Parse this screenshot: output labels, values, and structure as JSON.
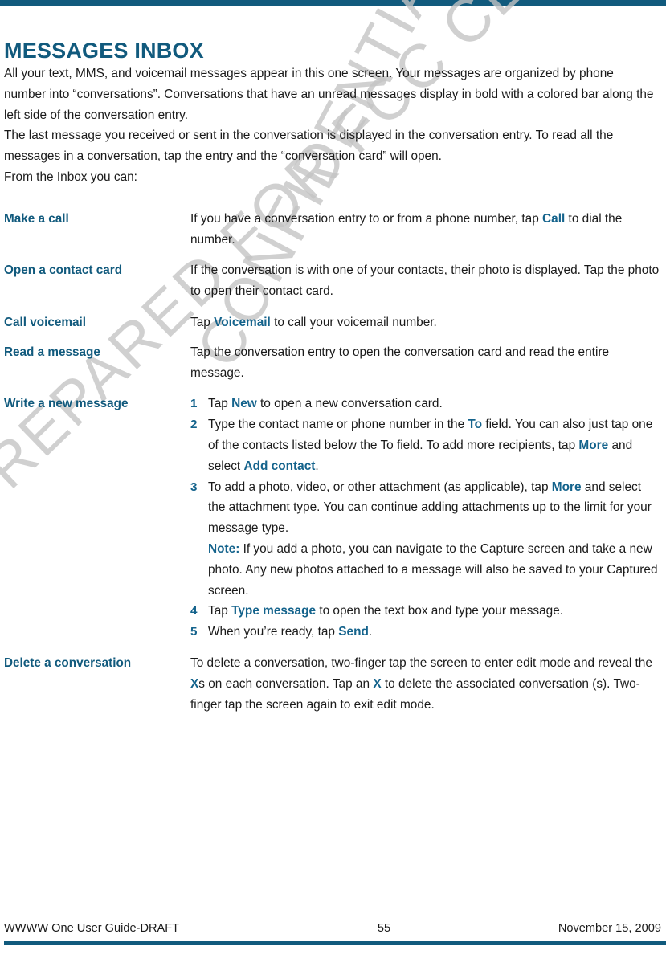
{
  "colors": {
    "accent": "#115a7d",
    "keyword": "#14638c",
    "body_text": "#1a1a1a",
    "watermark": "#c4c4c4"
  },
  "header": {
    "title": "MESSAGES INBOX"
  },
  "watermark": {
    "line1": "PREPARED FOR FCC CERTIFICATION",
    "line2": "CONFIDENTIAL"
  },
  "intro": {
    "para1": "All your text, MMS, and voicemail messages appear in this one screen. Your messages are organized by phone number into “conversations”. Conversations that have an unread messages display in bold with a colored bar along the left side of the conversation entry.",
    "para2": "The last message you received or sent in the conversation is displayed in the conversation entry. To read all the messages in a conversation, tap the entry and the “conversation card” will open.",
    "para3": "From the Inbox you can:"
  },
  "tasks": {
    "make_a_call": {
      "term": "Make a call",
      "desc_part1": "If you have a conversation entry to or from a phone number, tap ",
      "kw1": "Call",
      "desc_part2": " to dial the number."
    },
    "open_contact_card": {
      "term": "Open a contact card",
      "desc": "If the conversation is with one of your contacts, their photo is displayed. Tap the photo to open their contact card."
    },
    "call_voicemail": {
      "term": "Call voicemail",
      "desc_part1": "Tap ",
      "kw1": "Voicemail",
      "desc_part2": " to call your voicemail number."
    },
    "read_a_message": {
      "term": "Read a message",
      "desc": "Tap the conversation entry to open the conversation card and read the entire message."
    },
    "write_new_message": {
      "term": "Write a new message",
      "steps": [
        {
          "num": "1",
          "part1": "Tap ",
          "kw1": "New",
          "part2": " to open a new conversation card."
        },
        {
          "num": "2",
          "part1": "Type the contact name or phone number in the ",
          "kw1": "To",
          "part2": " field. You can also just tap one of the contacts listed below the To field. To add more recipients, tap ",
          "kw2": "More",
          "part3": " and select ",
          "kw3": "Add contact",
          "part4": "."
        },
        {
          "num": "3",
          "part1": "To add a photo, video, or other attachment (as applicable), tap ",
          "kw1": "More",
          "part2": " and select the attachment type. You can continue adding attachments up to the limit for your message type.",
          "note_label": "Note:",
          "note_text": " If you add a photo, you can navigate to the Capture screen and take a new photo. Any new photos attached to a message will also be saved to your Captured screen."
        },
        {
          "num": "4",
          "part1": "Tap ",
          "kw1": "Type message",
          "part2": " to open the text box and type your message."
        },
        {
          "num": "5",
          "part1": "When you’re ready, tap ",
          "kw1": "Send",
          "part2": "."
        }
      ]
    },
    "delete_conversation": {
      "term": "Delete a conversation",
      "part1": "To delete a conversation, two-finger tap the screen to enter edit mode and reveal the ",
      "kw1": "X",
      "part2": "s on each conversation. Tap an ",
      "kw2": "X",
      "part3": " to delete the associated conversation (s). Two-finger tap the screen again to exit edit mode."
    }
  },
  "footer": {
    "left": "WWWW One User Guide-DRAFT",
    "page_number": "55",
    "right": "November 15, 2009"
  }
}
